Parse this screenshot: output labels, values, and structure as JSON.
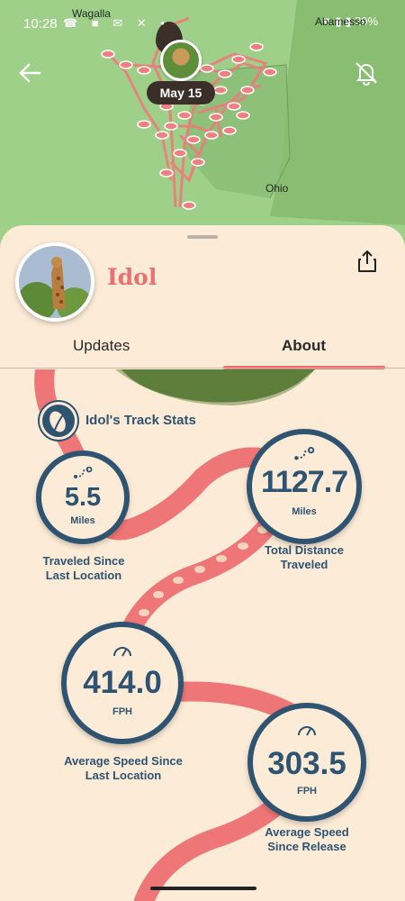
{
  "status_bar": {
    "time": "10:28",
    "icons": "☎ ■ ✉ ✕ •",
    "right": "▼ ▮ ▮ 29%"
  },
  "map": {
    "labels": {
      "wagalla": "Wagalla",
      "abameno": "Abamesso",
      "ohio": "Ohio"
    },
    "date": "May 15"
  },
  "profile": {
    "name": "Idol"
  },
  "tabs": [
    {
      "label": "Updates",
      "selected": false
    },
    {
      "label": "About",
      "selected": true
    }
  ],
  "track_stats": {
    "title": "Idol's Track Stats",
    "stats": [
      {
        "value": "5.5",
        "unit": "Miles",
        "caption": "Traveled Since\nLast Location",
        "icon": "route-icon"
      },
      {
        "value": "1127.7",
        "unit": "Miles",
        "caption": "Total Distance\nTraveled",
        "icon": "route-icon"
      },
      {
        "value": "414.0",
        "unit": "FPH",
        "caption": "Average Speed Since\nLast Location",
        "icon": "speedometer-icon"
      },
      {
        "value": "303.5",
        "unit": "FPH",
        "caption": "Average Speed\nSince Release",
        "icon": "speedometer-icon"
      }
    ]
  },
  "colors": {
    "accent": "#ec7070",
    "navy": "#2e5472",
    "sheet": "#fcebd6",
    "map_green": "#9fd08a"
  }
}
